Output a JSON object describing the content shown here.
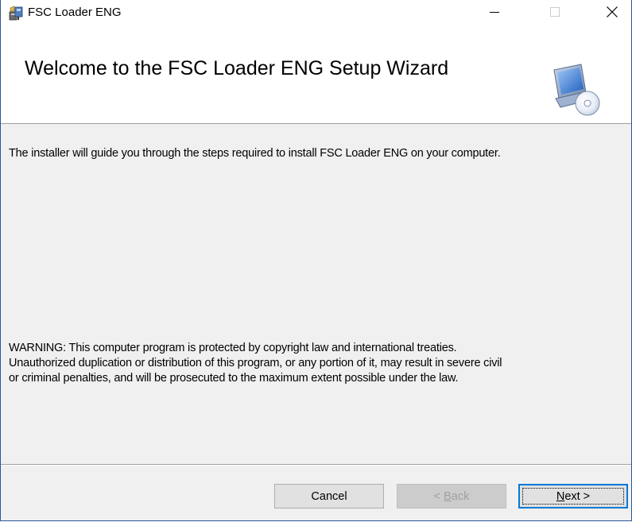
{
  "window": {
    "title": "FSC Loader ENG",
    "controls": {
      "minimize": "minimize",
      "maximize": "maximize",
      "close": "close"
    }
  },
  "banner": {
    "heading": "Welcome to the FSC Loader ENG Setup Wizard",
    "icon": "computer-with-cd-icon"
  },
  "body": {
    "intro": "The installer will guide you through the steps required to install FSC Loader ENG on your computer.",
    "warning_lines": [
      "WARNING: This computer program is protected by copyright law and international treaties.",
      "Unauthorized duplication or distribution of this program, or any portion of it, may result in severe civil",
      "or criminal penalties, and will be prosecuted to the maximum extent possible under the law."
    ]
  },
  "buttons": {
    "cancel": "Cancel",
    "back_prefix": "< ",
    "back_accel": "B",
    "back_rest": "ack",
    "next_accel": "N",
    "next_rest": "ext >"
  },
  "colors": {
    "accent": "#0078d7",
    "window_border": "#2b579a",
    "dialog_bg": "#f0f0f0"
  }
}
